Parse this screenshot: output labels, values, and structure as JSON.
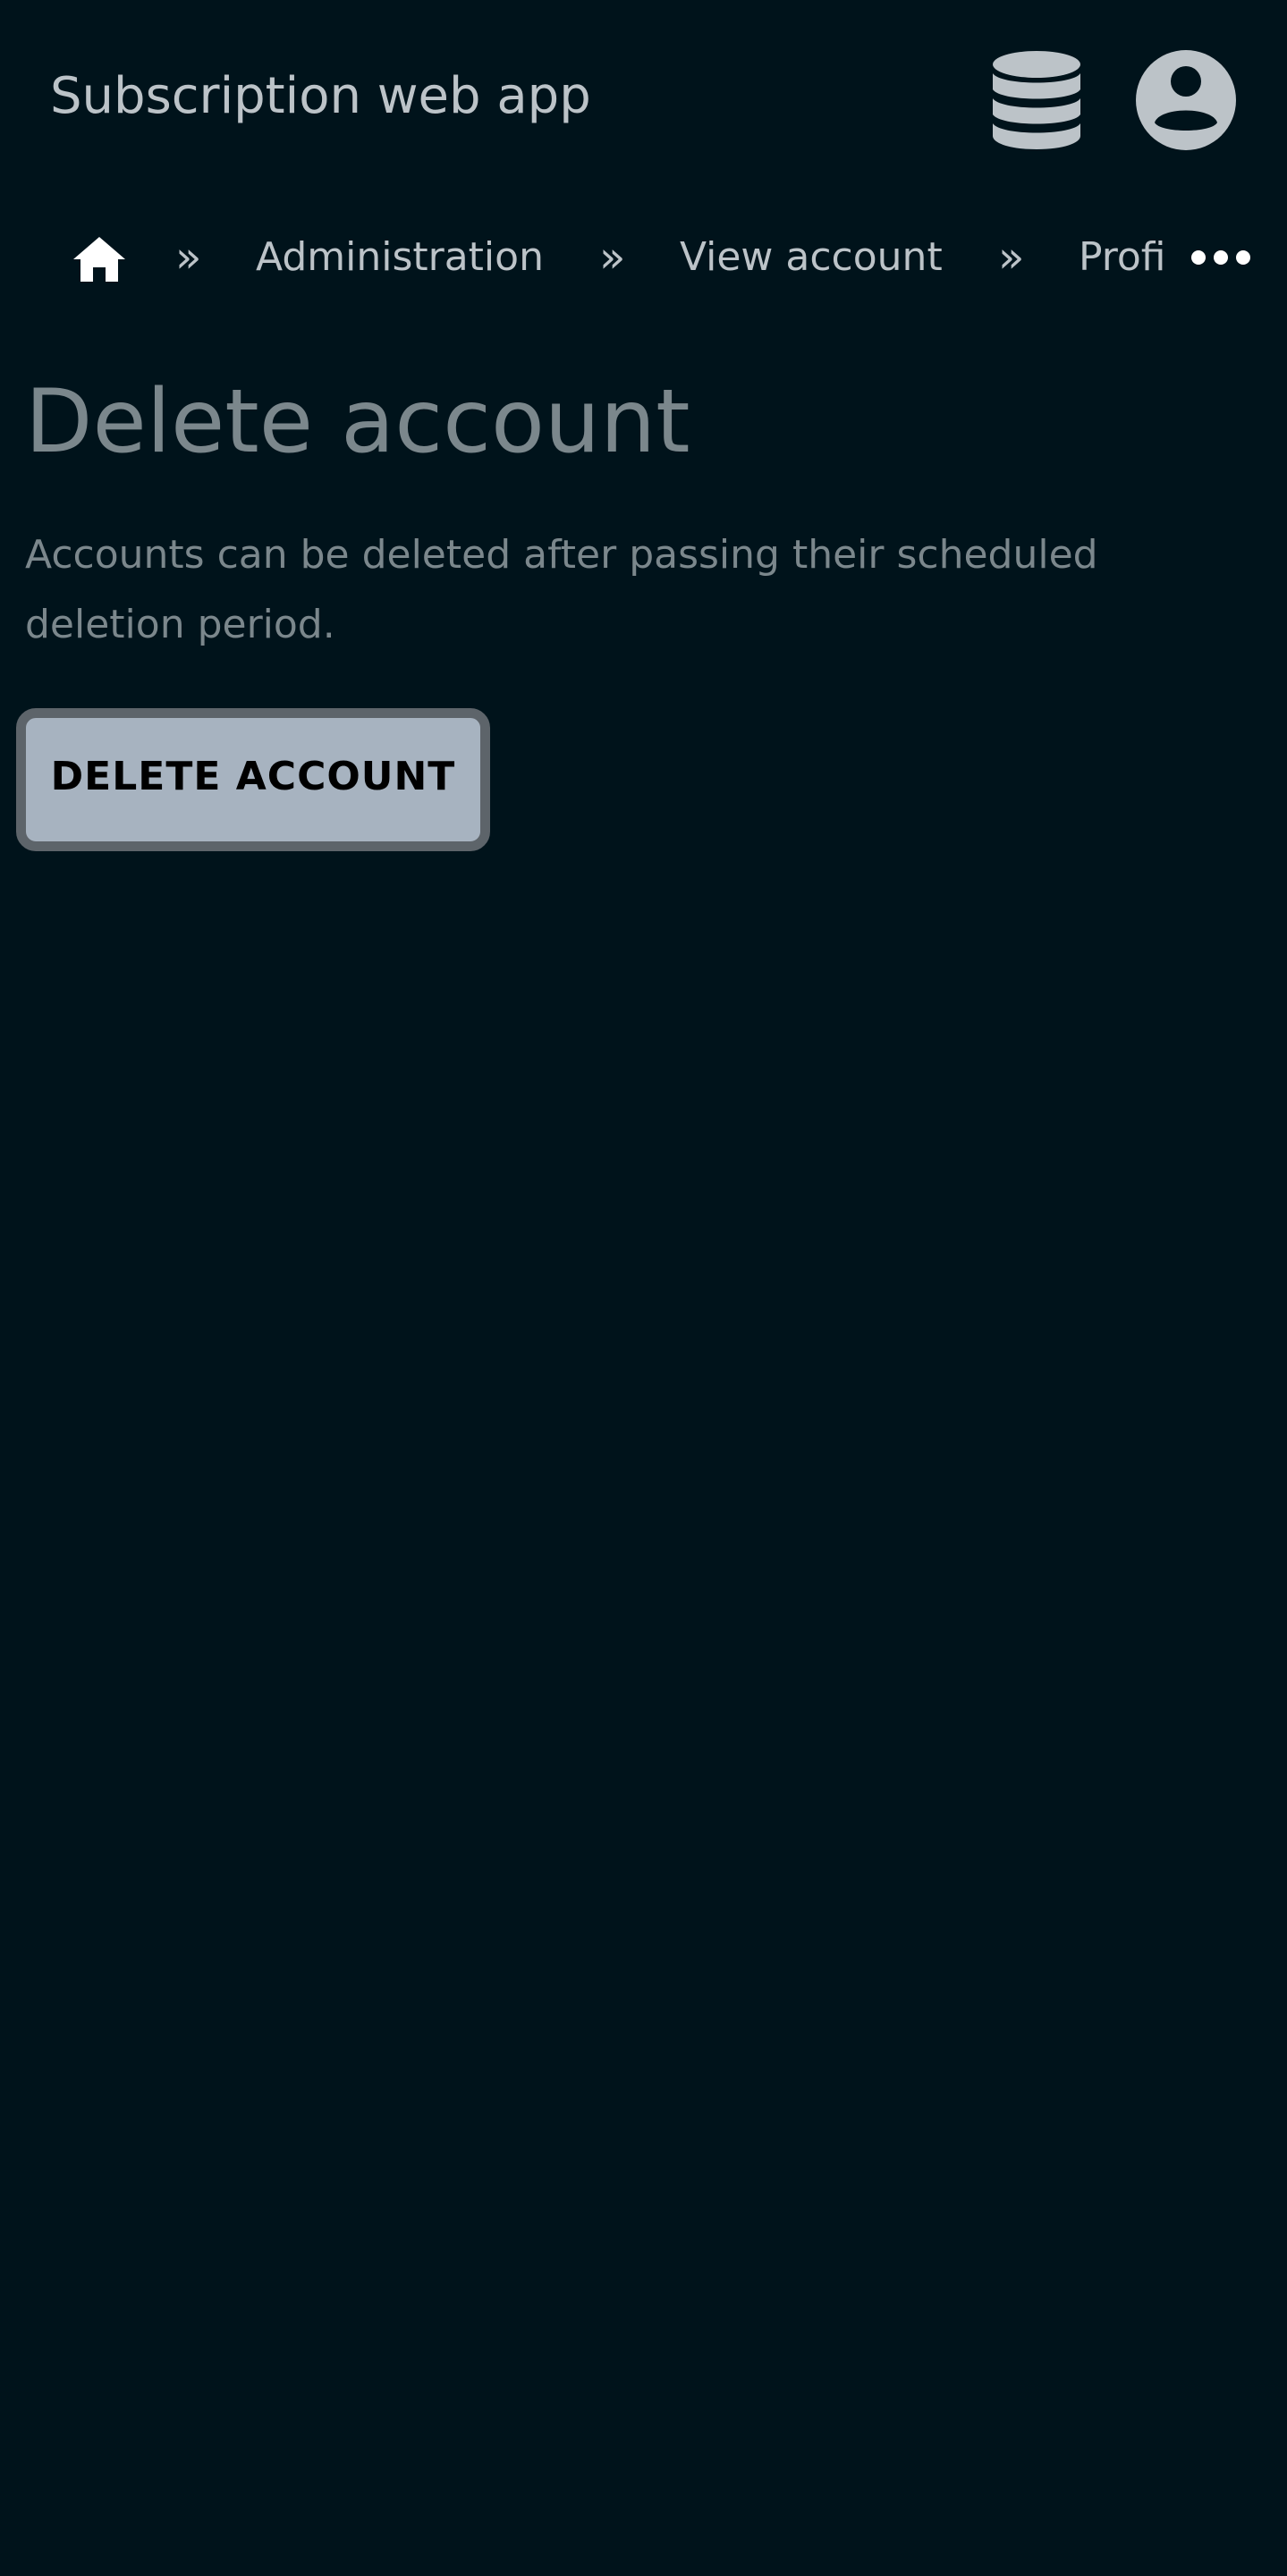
{
  "header": {
    "app_title": "Subscription web app",
    "icons": {
      "database": "database-icon",
      "account": "account-circle-icon"
    }
  },
  "breadcrumb": {
    "home_icon": "home-icon",
    "separator": "»",
    "items": [
      {
        "label": "Administration"
      },
      {
        "label": "View account"
      },
      {
        "label": "Profi"
      }
    ],
    "more_icon": "more-horizontal-icon"
  },
  "main": {
    "title": "Delete account",
    "description": "Accounts can be deleted after passing their scheduled deletion period.",
    "delete_button_label": "DELETE ACCOUNT"
  },
  "colors": {
    "background": "#00131b",
    "text_light": "#bcc3c8",
    "text_muted": "#7b878c",
    "button_bg": "#a7b3c0",
    "button_border": "#5d646a"
  }
}
